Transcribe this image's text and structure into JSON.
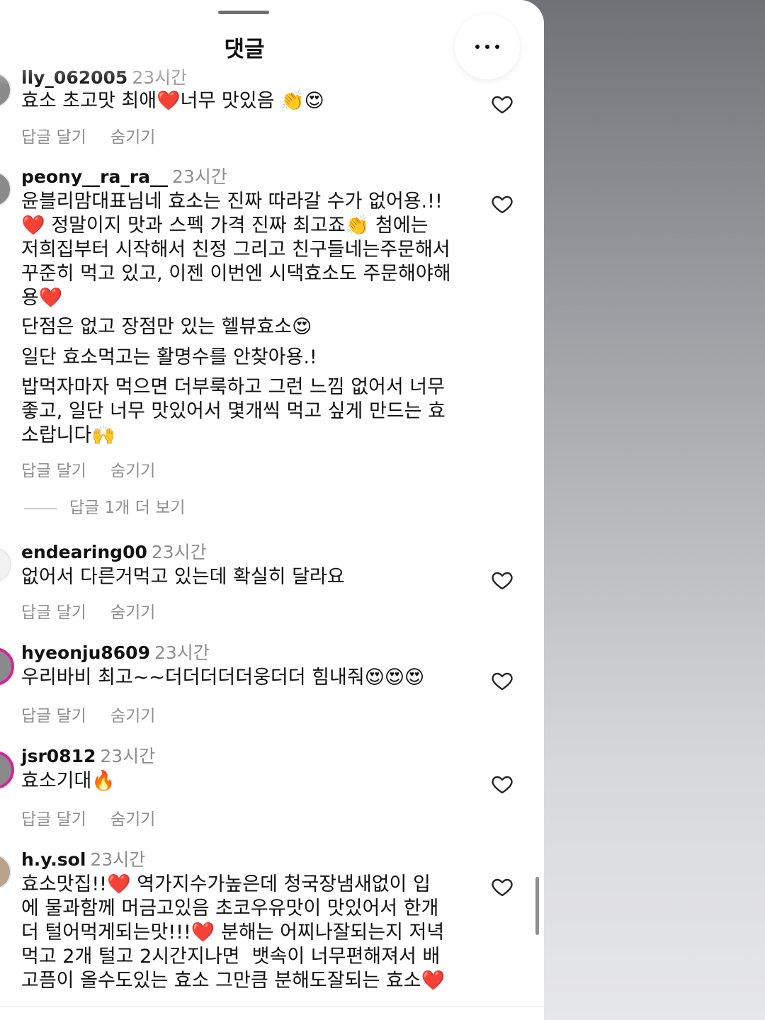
{
  "header": {
    "title": "댓글",
    "ghost_text": "",
    "more_icon": "more-horizontal-icon"
  },
  "comments": [
    {
      "username": "lly_062005",
      "time": "23시간",
      "text": "효소 초고맛 최애❤️너무 맛있음 👏😍",
      "reply": "답글 달기",
      "hide": "숨기기"
    },
    {
      "username": "peony__ra_ra__",
      "time": "23시간",
      "text": "윤블리맘대표님네 효소는 진짜 따라갈 수가 없어용.!!\n❤️ 정말이지 맛과 스펙 가격 진짜 최고죠👏 첨에는\n저희집부터 시작해서 친정 그리고 친구들네는주문해서\n꾸준히 먹고 있고, 이젠 이번엔 시댁효소도 주문해야해\n용❤️",
      "text2": "단점은 없고 장점만 있는 헬뷰효소😍",
      "text3": "일단 효소먹고는 활명수를 안찾아용.!",
      "text4": "밥먹자마자 먹으면 더부룩하고 그런 느낌 없어서 너무\n좋고, 일단 너무 맛있어서 몇개씩 먹고 싶게 만드는 효\n소랍니다🙌",
      "reply": "답글 달기",
      "hide": "숨기기",
      "view_replies": "답글 1개 더 보기"
    },
    {
      "username": "endearing00",
      "time": "23시간",
      "text": "없어서 다른거먹고 있는데 확실히 달라요",
      "reply": "답글 달기",
      "hide": "숨기기"
    },
    {
      "username": "hyeonju8609",
      "time": "23시간",
      "text": "우리바비 최고~~더더더더더웅더더 힘내줘😍😍😍",
      "reply": "답글 달기",
      "hide": "숨기기"
    },
    {
      "username": "jsr0812",
      "time": "23시간",
      "text": "효소기대🔥",
      "reply": "답글 달기",
      "hide": "숨기기"
    },
    {
      "username": "h.y.sol",
      "time": "23시간",
      "text": "효소맛집!!❤️ 역가지수가높은데 청국장냄새없이 입\n에 물과함께 머금고있음 초코우유맛이 맛있어서 한개\n더 털어먹게되는맛!!!❤️ 분해는 어찌나잘되는지 저녁\n먹고 2개 털고 2시간지나면  뱃속이 너무편해져서 배\n고픔이 올수도있는 효소 그만큼 분해도잘되는 효소❤️",
      "reply": "답글 달기",
      "hide": "숨기기"
    }
  ],
  "colors": {
    "sheet_bg": "#ffffff",
    "text": "#111111",
    "muted": "#8e8e8e",
    "story_ring": "#d6249f"
  }
}
